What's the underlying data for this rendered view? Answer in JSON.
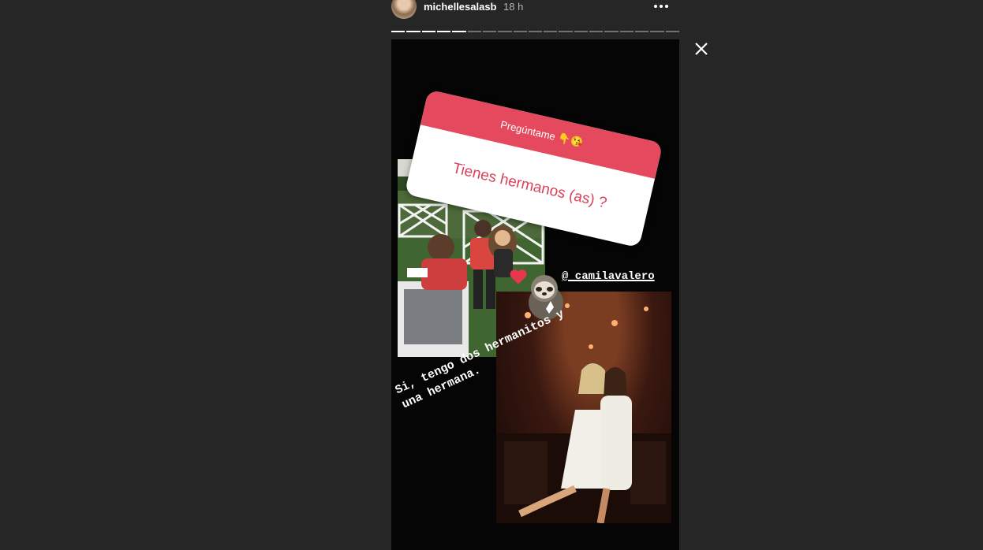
{
  "header": {
    "username": "michellesalasb",
    "time": "18 h",
    "more_icon": "more-horizontal-icon",
    "close_icon": "close-icon"
  },
  "progress": {
    "total_segments": 19,
    "completed_segments": 5
  },
  "story": {
    "question_sticker": {
      "title": "Pregúntame 👇😘",
      "question": "Tienes hermanos (as) ?",
      "header_color": "#e5495d",
      "text_color": "#d9425a"
    },
    "mention": "@_camilavalero",
    "caption": "Si, tengo dos hermanitos y\nuna hermana.",
    "stickers": [
      "heart-icon",
      "sloth-sticker-icon"
    ]
  },
  "colors": {
    "background": "#262626",
    "story_bg": "#050505"
  }
}
